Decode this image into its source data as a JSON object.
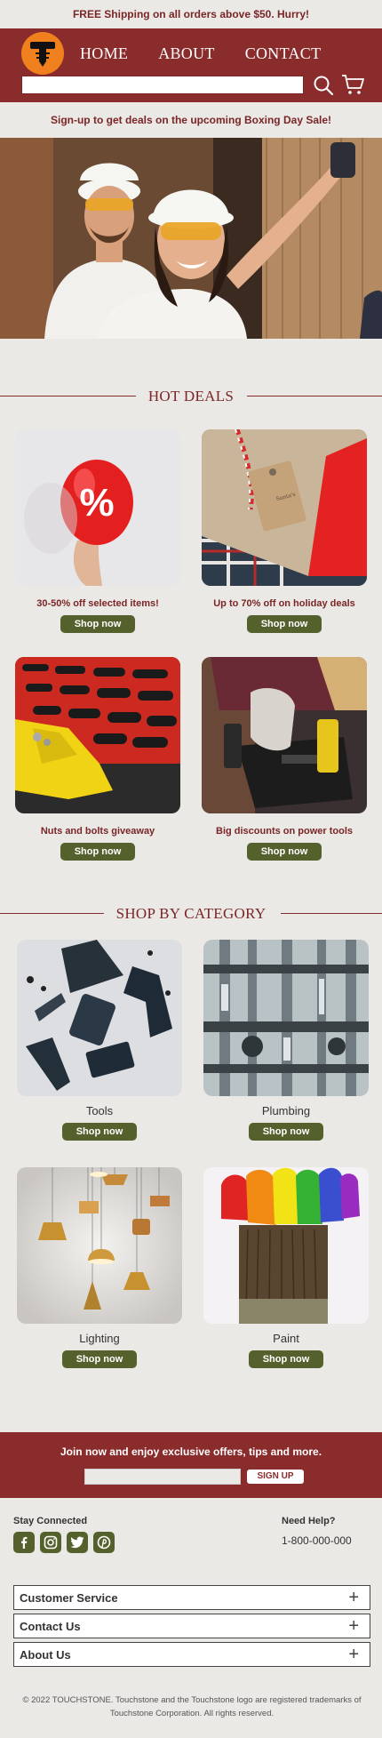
{
  "promo": {
    "text": "FREE Shipping on all orders above $50. Hurry!"
  },
  "header": {
    "logo_letter": "T",
    "nav": [
      "HOME",
      "ABOUT",
      "CONTACT"
    ],
    "search_placeholder": "",
    "search_icon": "search-icon",
    "cart_icon": "cart-icon"
  },
  "signup_banner": {
    "text": "Sign-up to get deals on the upcoming Boxing Day Sale!"
  },
  "hot_deals": {
    "title": "HOT DEALS",
    "items": [
      {
        "caption": "30-50% off selected items!",
        "button": "Shop now"
      },
      {
        "caption": "Up to 70% off on holiday deals",
        "button": "Shop now"
      },
      {
        "caption": "Nuts and bolts giveaway",
        "button": "Shop now"
      },
      {
        "caption": "Big discounts on power tools",
        "button": "Shop now"
      }
    ]
  },
  "categories": {
    "title": "SHOP BY CATEGORY",
    "items": [
      {
        "caption": "Tools",
        "button": "Shop now"
      },
      {
        "caption": "Plumbing",
        "button": "Shop now"
      },
      {
        "caption": "Lighting",
        "button": "Shop now"
      },
      {
        "caption": "Paint",
        "button": "Shop now"
      }
    ]
  },
  "newsletter": {
    "headline": "Join now and enjoy exclusive offers, tips and more.",
    "button": "SIGN UP"
  },
  "footer": {
    "stay_connected": "Stay Connected",
    "socials": [
      "facebook-icon",
      "instagram-icon",
      "twitter-icon",
      "pinterest-icon"
    ],
    "need_help": "Need Help?",
    "phone": "1-800-000-000",
    "accordions": [
      "Customer Service",
      "Contact Us",
      "About Us"
    ],
    "legal_line1": "© 2022 TOUCHSTONE. Touchstone and the Touchstone logo are registered trademarks of",
    "legal_line2": "Touchstone Corporation. All rights reserved."
  },
  "colors": {
    "brand": "#8a2b2c",
    "accent": "#55612d",
    "logo": "#f0801d",
    "background": "#ebe9e6"
  }
}
